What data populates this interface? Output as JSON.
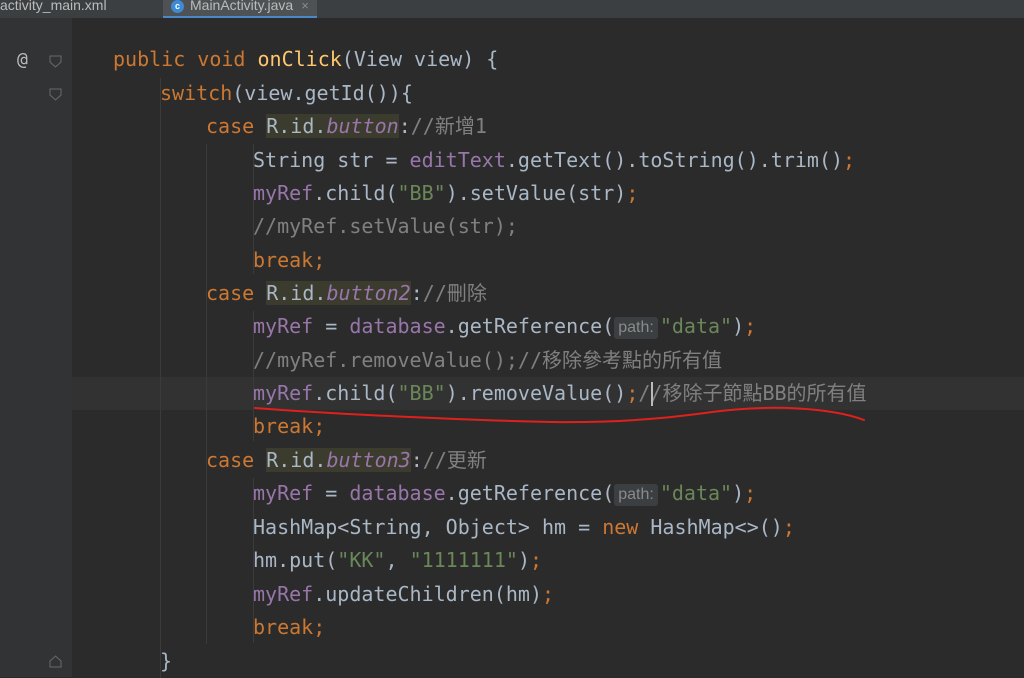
{
  "tabs": [
    {
      "label": "activity_main.xml",
      "active": false
    },
    {
      "label": "MainActivity.java",
      "active": true,
      "icon": "java-class-icon",
      "close": "×"
    }
  ],
  "gutter": {
    "override_marker": "@"
  },
  "code": {
    "l1": {
      "a": "public void ",
      "b": "onClick",
      "c": "(View view) {"
    },
    "l2": {
      "a": "switch",
      "b": "(view.getId()){"
    },
    "l3": {
      "a": "case ",
      "b": "R.id.",
      "c": "button",
      "d": ":",
      "e": "//新增1"
    },
    "l4": {
      "a": "String str = ",
      "b": "editText",
      "c": ".getText().toString().trim()",
      "d": ";"
    },
    "l5": {
      "a": "myRef",
      "b": ".child(",
      "c": "\"BB\"",
      "d": ").setValue(str)",
      "e": ";"
    },
    "l6": {
      "a": "//myRef.setValue(str);"
    },
    "l7": {
      "a": "break;"
    },
    "l8": {
      "a": "case ",
      "b": "R.id.",
      "c": "button2",
      "d": ":",
      "e": "//刪除"
    },
    "l9": {
      "a": "myRef",
      "b": " = ",
      "c": "database",
      "d": ".getReference(",
      "hint": "path:",
      "e": "\"data\"",
      "f": ")",
      "g": ";"
    },
    "l10": {
      "a": "//myRef.removeValue();//移除參考點的所有值"
    },
    "l11": {
      "a": "myRef",
      "b": ".child(",
      "c": "\"BB\"",
      "d": ").removeValue()",
      "e": ";",
      "f": "//",
      "g": "移除子節點BB的所有值"
    },
    "l12": {
      "a": "break;"
    },
    "l13": {
      "a": "case ",
      "b": "R.id.",
      "c": "button3",
      "d": ":",
      "e": "//更新"
    },
    "l14": {
      "a": "myRef",
      "b": " = ",
      "c": "database",
      "d": ".getReference(",
      "hint": "path:",
      "e": "\"data\"",
      "f": ")",
      "g": ";"
    },
    "l15": {
      "a": "HashMap<String, Object> hm = ",
      "b": "new ",
      "c": "HashMap<>()",
      "d": ";"
    },
    "l16": {
      "a": "hm.put(",
      "b": "\"KK\"",
      "c": ", ",
      "d": "\"1111111\"",
      "e": ")",
      "f": ";"
    },
    "l17": {
      "a": "myRef",
      "b": ".updateChildren(hm)",
      "c": ";"
    },
    "l18": {
      "a": "break;"
    },
    "l19": {
      "a": "}"
    }
  },
  "colors": {
    "background": "#2b2b2b",
    "keyword": "#cc7832",
    "string": "#6a8759",
    "field": "#9876aa",
    "comment": "#808080",
    "method": "#ffc66d",
    "annotation_stroke": "#e0201c"
  }
}
